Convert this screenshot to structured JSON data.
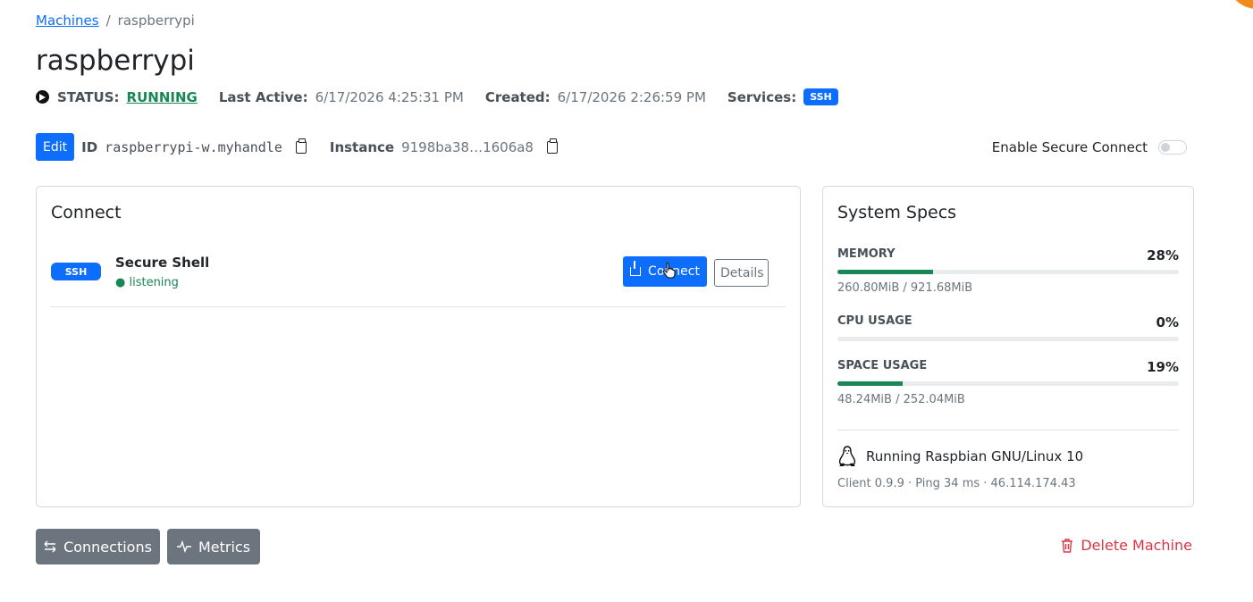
{
  "breadcrumb": {
    "root": "Machines",
    "separator": "/",
    "current": "raspberrypi"
  },
  "machine": {
    "title": "raspberrypi"
  },
  "status": {
    "label": "STATUS:",
    "value": "RUNNING",
    "last_active_label": "Last Active:",
    "last_active": "6/17/2026 4:25:31 PM",
    "created_label": "Created:",
    "created": "6/17/2026 2:26:59 PM",
    "services_label": "Services:",
    "service_badge": "SSH"
  },
  "identity": {
    "edit_label": "Edit",
    "id_label": "ID",
    "id_value": "raspberrypi-w.myhandle",
    "instance_label": "Instance",
    "instance_value": "9198ba38…1606a8",
    "secure_connect_label": "Enable Secure Connect",
    "secure_connect_enabled": false
  },
  "connect_card": {
    "title": "Connect",
    "services": [
      {
        "badge": "SSH",
        "name": "Secure Shell",
        "status": "● listening",
        "connect_label": "Connect",
        "details_label": "Details"
      }
    ]
  },
  "specs_card": {
    "title": "System Specs",
    "memory": {
      "label": "MEMORY",
      "percent": "28%",
      "fraction": 0.28,
      "detail": "260.80MiB / 921.68MiB"
    },
    "cpu": {
      "label": "CPU USAGE",
      "percent": "0%",
      "fraction": 0.0
    },
    "space": {
      "label": "SPACE USAGE",
      "percent": "19%",
      "fraction": 0.19,
      "detail": "48.24MiB / 252.04MiB"
    },
    "os": "Running Raspbian GNU/Linux 10",
    "client_info": "Client 0.9.9 · Ping 34 ms · 46.114.174.43"
  },
  "actions": {
    "connections_label": "Connections",
    "metrics_label": "Metrics",
    "delete_label": "Delete Machine"
  },
  "colors": {
    "primary": "#0d6efd",
    "success": "#198754",
    "secondary": "#6c757d",
    "danger": "#dc3545"
  }
}
